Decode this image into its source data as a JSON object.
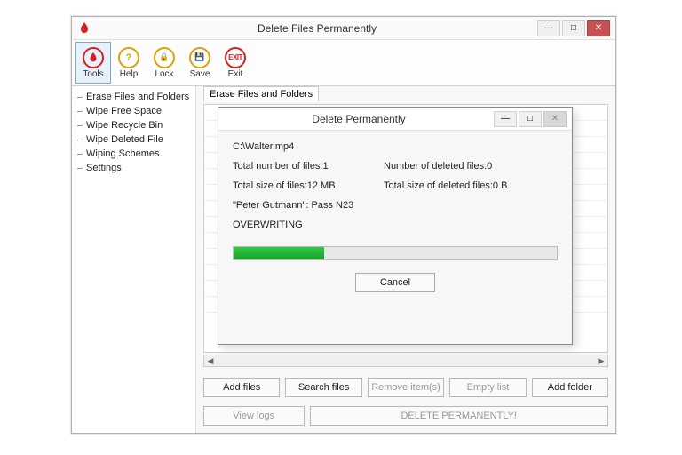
{
  "main": {
    "title": "Delete Files Permanently",
    "toolbar": [
      {
        "name": "tools",
        "label": "Tools",
        "icon": "flame",
        "glyph": "",
        "selected": true
      },
      {
        "name": "help",
        "label": "Help",
        "icon": "help",
        "glyph": "?"
      },
      {
        "name": "lock",
        "label": "Lock",
        "icon": "lock",
        "glyph": "🔒"
      },
      {
        "name": "save",
        "label": "Save",
        "icon": "save",
        "glyph": "💾"
      },
      {
        "name": "exit",
        "label": "Exit",
        "icon": "exit",
        "glyph": "EXIT"
      }
    ],
    "sidebar": [
      "Erase Files and Folders",
      "Wipe Free Space",
      "Wipe Recycle Bin",
      "Wipe Deleted File",
      "Wiping Schemes",
      "Settings"
    ],
    "tab_label": "Erase Files and Folders",
    "buttons_row1": [
      {
        "label": "Add files",
        "enabled": true
      },
      {
        "label": "Search files",
        "enabled": true
      },
      {
        "label": "Remove item(s)",
        "enabled": false
      },
      {
        "label": "Empty list",
        "enabled": false
      },
      {
        "label": "Add folder",
        "enabled": true
      }
    ],
    "buttons_row2": [
      {
        "label": "View logs",
        "enabled": false,
        "wide": false
      },
      {
        "label": "DELETE PERMANENTLY!",
        "enabled": false,
        "wide": true
      }
    ]
  },
  "dialog": {
    "title": "Delete Permanently",
    "file_path": "C:\\Walter.mp4",
    "total_files_label": "Total number of files:",
    "total_files_value": "1",
    "deleted_files_label": "Number of deleted files:",
    "deleted_files_value": "0",
    "total_size_label": "Total size of files:",
    "total_size_value": "12 MB",
    "deleted_size_label": "Total size of deleted files:",
    "deleted_size_value": "0 B",
    "scheme": "\"Peter Gutmann\": Pass N23",
    "status": "OVERWRITING",
    "progress_percent": 28,
    "cancel_label": "Cancel"
  }
}
